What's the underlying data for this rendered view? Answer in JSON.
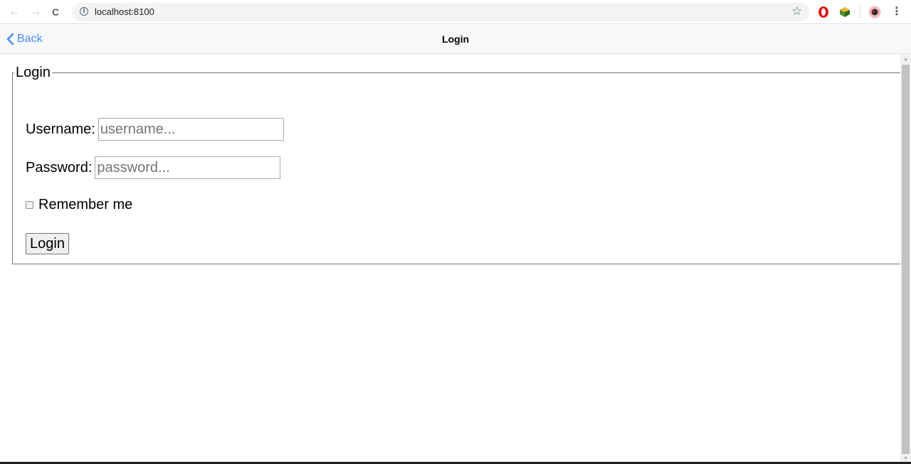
{
  "browser": {
    "url": "localhost:8100",
    "back_glyph": "←",
    "forward_glyph": "→",
    "reload_glyph": "C",
    "star_glyph": "☆",
    "menu_glyph": "⋮",
    "icons": [
      "back-arrow-icon",
      "forward-arrow-icon",
      "reload-icon",
      "info-icon",
      "bookmark-star-icon",
      "opera-icon",
      "extension-icon",
      "profile-avatar-icon",
      "menu-icon"
    ]
  },
  "header": {
    "back_label": "Back",
    "title": "Login",
    "accent_color": "#4a8bfc"
  },
  "form": {
    "legend": "Login",
    "username_label": "Username:",
    "username_placeholder": "username...",
    "username_value": "",
    "password_label": "Password:",
    "password_placeholder": "password...",
    "password_value": "",
    "remember_label": "Remember me",
    "remember_checked": false,
    "submit_label": "Login"
  }
}
